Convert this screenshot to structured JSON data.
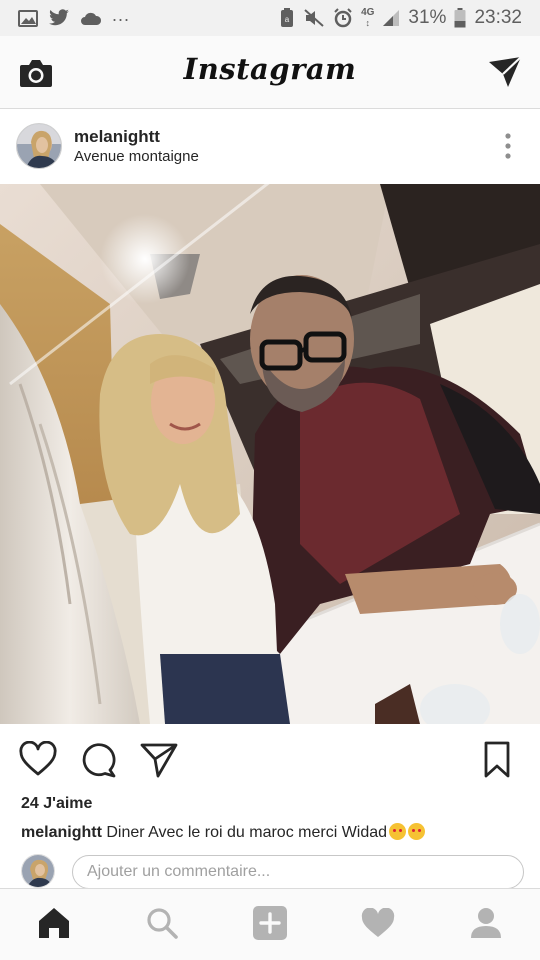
{
  "status_bar": {
    "dots": "...",
    "network": "4G",
    "battery_percent": "31%",
    "time": "23:32"
  },
  "header": {
    "app_title": "Instagram",
    "icons": [
      "camera-icon",
      "direct-message-icon"
    ]
  },
  "post": {
    "username": "melanightt",
    "location": "Avenue montaigne",
    "likes": "24 J'aime",
    "caption_user": "melanightt",
    "caption_text": "Diner Avec le roi du maroc merci Widad",
    "caption_emojis": [
      "kissing-heart-emoji",
      "kissing-emoji"
    ]
  },
  "comment": {
    "placeholder": "Ajouter un commentaire..."
  },
  "bottom_nav": {
    "items": [
      "home-icon",
      "search-icon",
      "add-post-icon",
      "activity-heart-icon",
      "profile-icon"
    ]
  },
  "colors": {
    "text": "#262626",
    "header_bg": "#fafafa",
    "status_bg": "#f1f1f1",
    "border": "#dbdbdb"
  }
}
